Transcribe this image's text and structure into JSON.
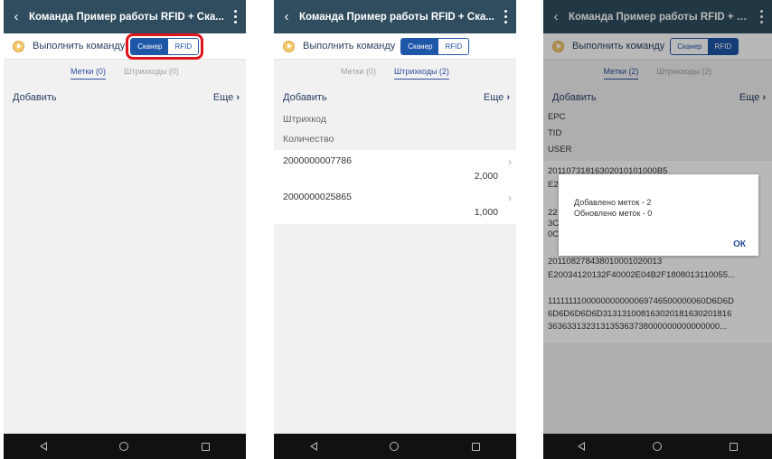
{
  "app": {
    "title": "Команда Пример работы RFID + Ска..."
  },
  "command": {
    "label": "Выполнить команду",
    "scanner": "Сканер",
    "rfid": "RFID"
  },
  "toolbar": {
    "add": "Добавить",
    "more": "Еще"
  },
  "screen1": {
    "tab_tags": "Метки (0)",
    "tab_barcodes": "Штрихкоды (0)"
  },
  "screen2": {
    "tab_tags": "Метки (0)",
    "tab_barcodes": "Штрихкоды (2)",
    "field_barcode": "Штрихкод",
    "field_qty": "Количество",
    "rows": [
      {
        "code": "2000000007786",
        "qty": "2,000"
      },
      {
        "code": "2000000025865",
        "qty": "1,000"
      }
    ]
  },
  "screen3": {
    "tab_tags": "Метки (2)",
    "tab_barcodes": "Штрихкоды (2)",
    "fields": [
      "EPC",
      "TID",
      "USER"
    ],
    "tag1_line1": "20110731816302010101000B5",
    "tag1_line2": "E2",
    "tag1_line3": "22",
    "tag1_line4": "3C",
    "tag1_line5": "0C",
    "tag2_line1": "201108278438010001020013",
    "tag2_line2": "E20034120132F40002E04B2F1808013110055...",
    "tag3_line1": "1111111100000000000069746500000060D6D6D",
    "tag3_line2": "6D6D6D6D6D313131008163020181630201816",
    "tag3_line3": "363633132313135363738000000000000000...",
    "dialog": {
      "line1": "Добавлено меток - 2",
      "line2": "Обновлено меток - 0",
      "ok": "ОК"
    }
  }
}
